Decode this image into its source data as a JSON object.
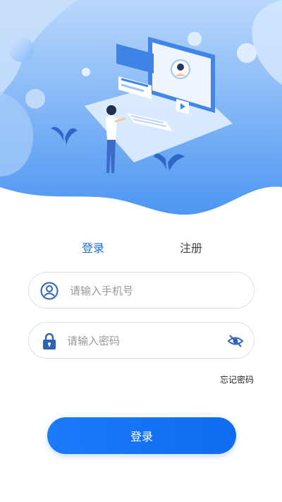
{
  "tabs": {
    "login": "登录",
    "register": "注册"
  },
  "phone": {
    "placeholder": "请输入手机号"
  },
  "password": {
    "placeholder": "请输入密码"
  },
  "forgot_password": "忘记密码",
  "login_button": "登录",
  "colors": {
    "accent": "#1a7af8",
    "tab_active": "#1e6fd9",
    "hero_blue": "#5ea4f5"
  },
  "icons": [
    "user-icon",
    "lock-icon",
    "eye-hidden-icon"
  ]
}
